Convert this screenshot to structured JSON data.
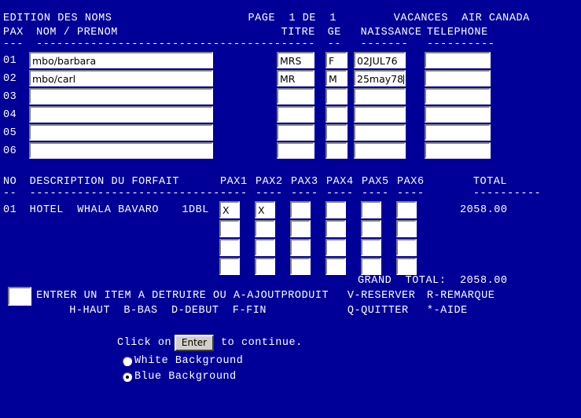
{
  "colors": {
    "background": "#000099",
    "field_background": "#ffffff",
    "text": "#ffffff",
    "button_face": "#d4d0c8"
  },
  "header": {
    "screen_title": "EDITION DES NOMS",
    "page_label": "PAGE  1 DE  1",
    "brand": "VACANCES  AIR CANADA"
  },
  "pax_table": {
    "columns": {
      "pax": "PAX",
      "name": "NOM / PRENOM",
      "title": "TITRE",
      "gender": "GE",
      "birth": "NAISSANCE",
      "phone": "TELEPHONE"
    },
    "rules": {
      "pax": "---",
      "name": "------------------------------------",
      "title": "-----",
      "gender": "--",
      "birth": "-------",
      "phone": "----------"
    },
    "rows": [
      {
        "no": "01",
        "name": "mbo/barbara",
        "title": "MRS",
        "gender": "F",
        "birth": "02JUL76",
        "phone": "",
        "caret": false
      },
      {
        "no": "02",
        "name": "mbo/carl",
        "title": "MR",
        "gender": "M",
        "birth": "25may78",
        "phone": "",
        "caret": true
      },
      {
        "no": "03",
        "name": "",
        "title": "",
        "gender": "",
        "birth": "",
        "phone": "",
        "caret": false
      },
      {
        "no": "04",
        "name": "",
        "title": "",
        "gender": "",
        "birth": "",
        "phone": "",
        "caret": false
      },
      {
        "no": "05",
        "name": "",
        "title": "",
        "gender": "",
        "birth": "",
        "phone": "",
        "caret": false
      },
      {
        "no": "06",
        "name": "",
        "title": "",
        "gender": "",
        "birth": "",
        "phone": "",
        "caret": false
      }
    ]
  },
  "forfait_table": {
    "columns": {
      "no": "NO",
      "description": "DESCRIPTION DU FORFAIT",
      "pax1": "PAX1",
      "pax2": "PAX2",
      "pax3": "PAX3",
      "pax4": "PAX4",
      "pax5": "PAX5",
      "pax6": "PAX6",
      "total": "TOTAL"
    },
    "rules": {
      "no": "--",
      "description": "------------------------------",
      "pax": "----",
      "total": "----------"
    },
    "rows": [
      {
        "no": "01",
        "description": "HOTEL  WHALA BAVARO",
        "room": "1DBL",
        "pax": [
          "X",
          "X",
          "",
          "",
          "",
          ""
        ],
        "total": "2058.00"
      },
      {
        "no": "",
        "description": "",
        "room": "",
        "pax": [
          "",
          "",
          "",
          "",
          "",
          ""
        ],
        "total": ""
      },
      {
        "no": "",
        "description": "",
        "room": "",
        "pax": [
          "",
          "",
          "",
          "",
          "",
          ""
        ],
        "total": ""
      },
      {
        "no": "",
        "description": "",
        "room": "",
        "pax": [
          "",
          "",
          "",
          "",
          "",
          ""
        ],
        "total": ""
      }
    ],
    "grand_total_label": "GRAND  TOTAL:",
    "grand_total_value": "2058.00"
  },
  "command": {
    "input_value": "",
    "line1": "ENTRER UN ITEM A DETRUIRE OU A-AJOUT",
    "line1_produit": "PRODUIT",
    "line1_reserver": "V-RESERVER",
    "line1_remarque": "R-REMARQUE",
    "line2_nav": "H-HAUT  B-BAS  D-DEBUT  F-FIN",
    "line2_quitter": "Q-QUITTER",
    "line2_aide": "*-AIDE"
  },
  "footer": {
    "click_prefix": "Click on",
    "enter_button": "Enter",
    "click_suffix": "to continue.",
    "options": [
      {
        "label": "White Background",
        "selected": false
      },
      {
        "label": "Blue Background",
        "selected": true
      }
    ]
  }
}
